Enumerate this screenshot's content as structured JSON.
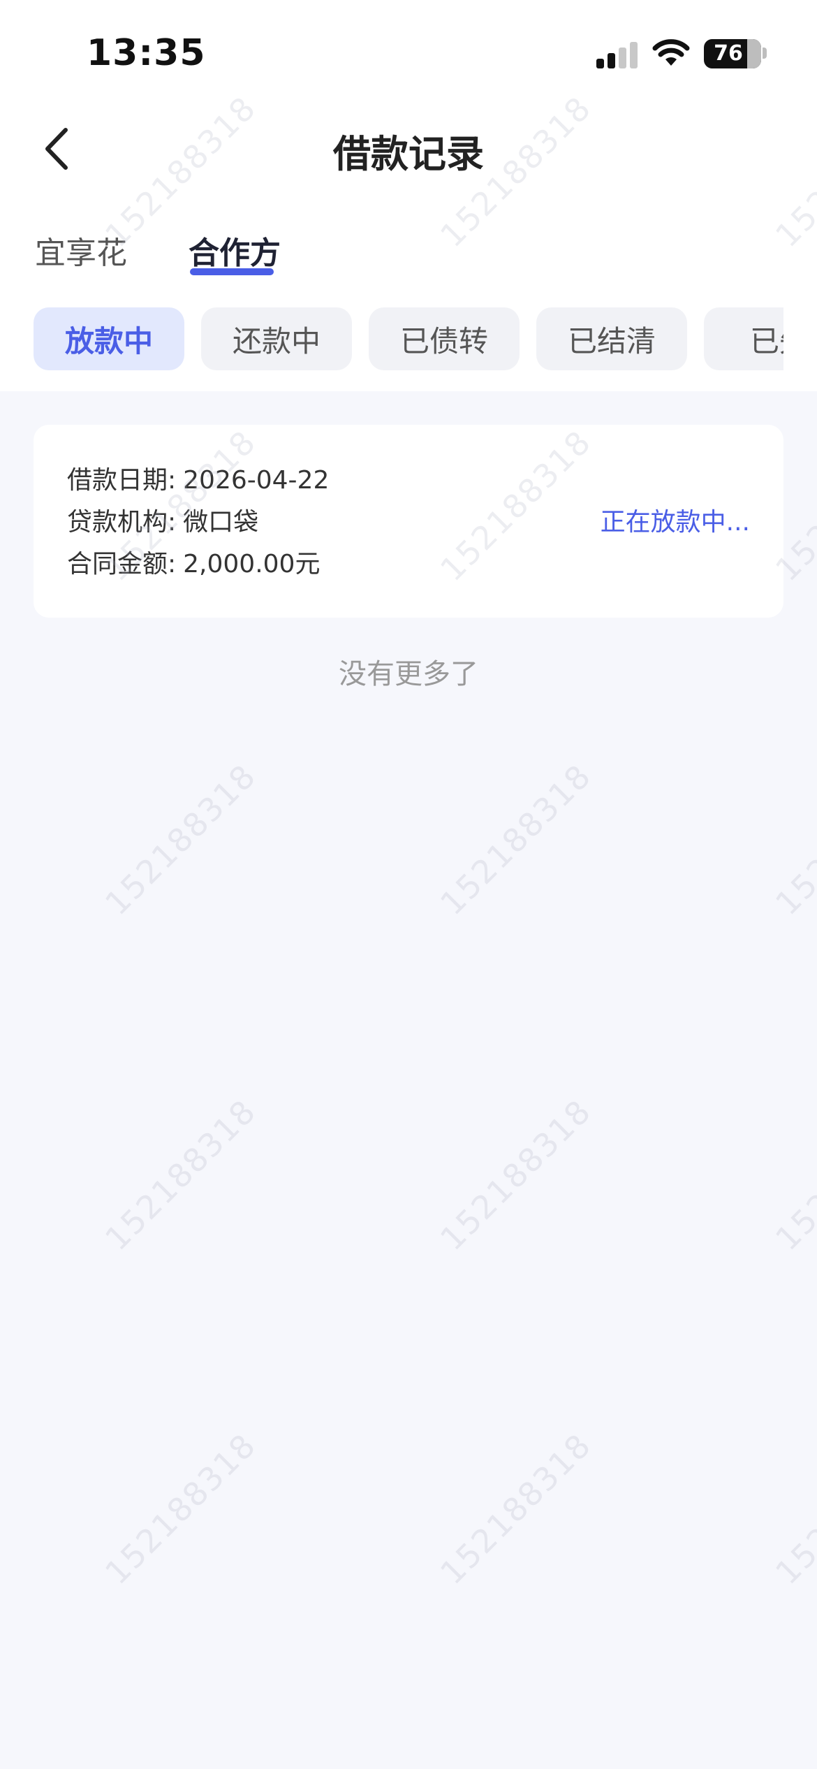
{
  "status_bar": {
    "time": "13:35",
    "battery": "76"
  },
  "nav": {
    "title": "借款记录"
  },
  "tabs": [
    {
      "label": "宜享花",
      "active": false
    },
    {
      "label": "合作方",
      "active": true
    }
  ],
  "filters": [
    {
      "label": "放款中",
      "active": true
    },
    {
      "label": "还款中",
      "active": false
    },
    {
      "label": "已债转",
      "active": false
    },
    {
      "label": "已结清",
      "active": false
    },
    {
      "label": "已失",
      "active": false
    }
  ],
  "records": [
    {
      "date_label": "借款日期:",
      "date": "2026-04-22",
      "lender_label": "贷款机构:",
      "lender": "微口袋",
      "amount_label": "合同金额:",
      "amount": "2,000.00元",
      "status": "正在放款中..."
    }
  ],
  "footer": {
    "no_more": "没有更多了"
  },
  "watermark": "152188318",
  "colors": {
    "accent": "#4a5ee6",
    "chip_active_bg": "#e2e8fd",
    "page_bg": "#f6f7fc"
  }
}
